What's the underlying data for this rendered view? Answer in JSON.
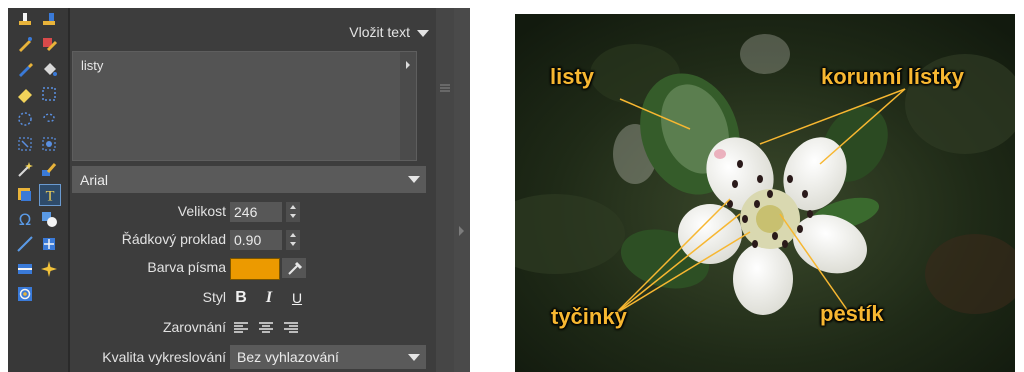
{
  "panel": {
    "title": "Vložit text",
    "text_value": "listy",
    "font": "Arial",
    "size_label": "Velikost",
    "size_value": "246",
    "line_spacing_label": "Řádkový proklad",
    "line_spacing_value": "0.90",
    "font_color_label": "Barva písma",
    "font_color": "#ec9a00",
    "style_label": "Styl",
    "bold_label": "B",
    "italic_label": "I",
    "underline_label": "U",
    "align_label": "Zarovnání",
    "quality_label": "Kvalita vykreslování",
    "quality_value": "Bez vyhlazování"
  },
  "toolbox": {
    "tools": [
      "stamp-icon",
      "stamp-alt-icon",
      "brush-icon",
      "heal-icon",
      "pencil-icon",
      "fill-icon",
      "eraser-icon",
      "rect-select-icon",
      "ellipse-select-icon",
      "lasso-select-icon",
      "magic-wand-icon",
      "magnetic-lasso-icon",
      "wand-icon",
      "color-picker-icon",
      "clone-icon",
      "text-tool-icon",
      "omega-icon",
      "shapes-icon",
      "line-icon",
      "crop-icon",
      "gradient-icon",
      "star-icon",
      "lens-icon"
    ]
  },
  "photo": {
    "labels": {
      "leaves": "listy",
      "petals": "korunní lístky",
      "stamens": "tyčinky",
      "pistil": "pestík"
    },
    "label_color": "#f7b731"
  }
}
